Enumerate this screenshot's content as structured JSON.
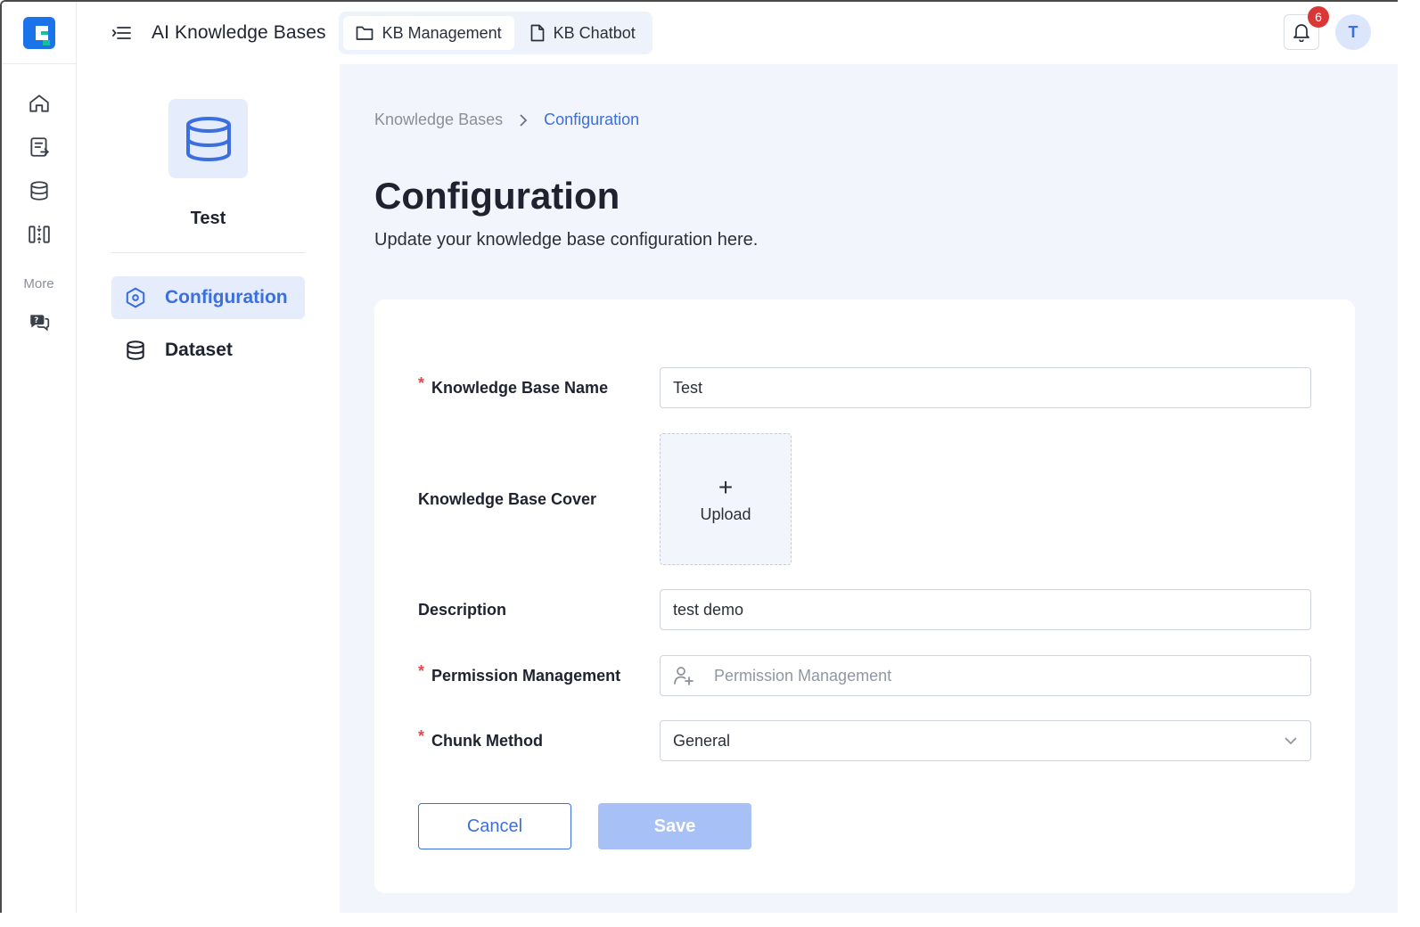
{
  "header": {
    "app_title": "AI Knowledge Bases",
    "tabs": [
      {
        "label": "KB Management",
        "icon": "folder-icon",
        "active": true
      },
      {
        "label": "KB Chatbot",
        "icon": "document-icon",
        "active": false
      }
    ],
    "notification_count": "6",
    "avatar_initial": "T"
  },
  "rail": {
    "more_label": "More",
    "icons": [
      "home-icon",
      "document-export-icon",
      "database-icon",
      "layout-columns-icon",
      "help-chat-icon"
    ]
  },
  "kb_sidebar": {
    "name": "Test",
    "nav": [
      {
        "label": "Configuration",
        "icon": "settings-hex-icon",
        "active": true
      },
      {
        "label": "Dataset",
        "icon": "database-icon",
        "active": false
      }
    ]
  },
  "main": {
    "breadcrumb": [
      "Knowledge Bases",
      "Configuration"
    ],
    "title": "Configuration",
    "subtitle": "Update your knowledge base configuration here.",
    "form": {
      "name_label": "Knowledge Base Name",
      "name_value": "Test",
      "cover_label": "Knowledge Base Cover",
      "upload_label": "Upload",
      "description_label": "Description",
      "description_value": "test demo",
      "permission_label": "Permission Management",
      "permission_placeholder": "Permission Management",
      "chunk_label": "Chunk Method",
      "chunk_value": "General",
      "required_mark": "*"
    },
    "cancel_label": "Cancel",
    "save_label": "Save"
  },
  "colors": {
    "accent": "#3b6fe0",
    "accent_light": "#e5edfc",
    "save_disabled": "#a7c1f6",
    "badge": "#d93636",
    "main_bg": "#f2f5fc"
  }
}
